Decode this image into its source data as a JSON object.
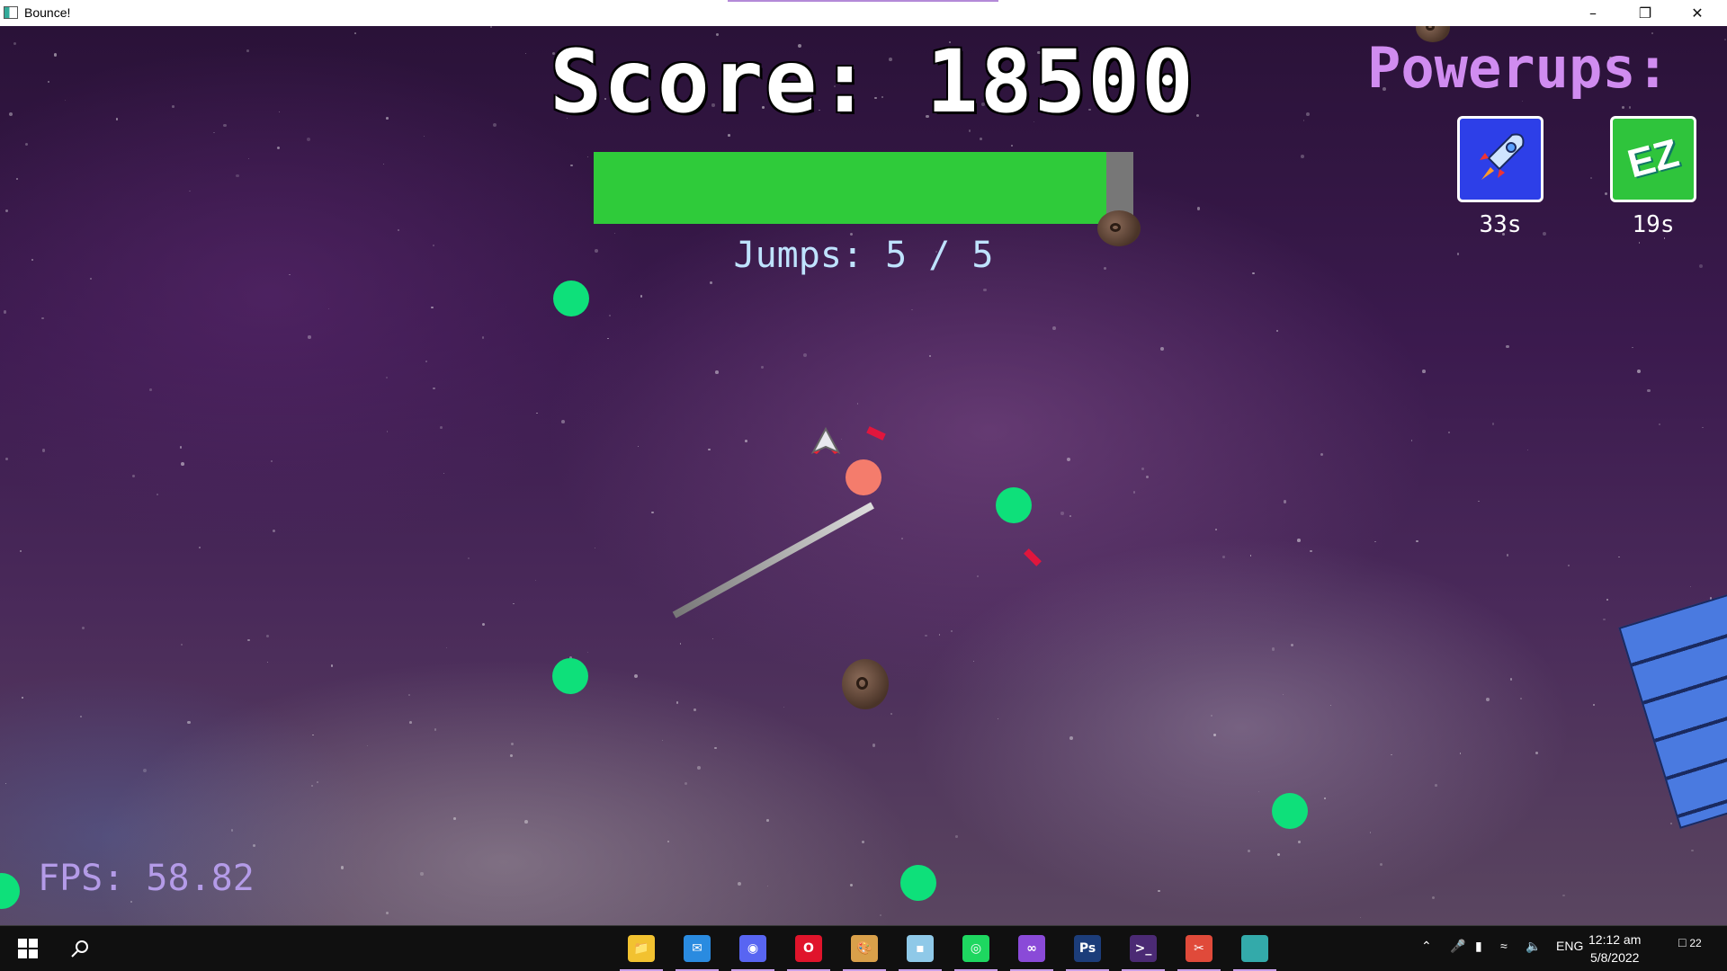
{
  "window": {
    "title": "Bounce!",
    "minimize_icon": "minimize-icon",
    "maximize_icon": "restore-icon",
    "close_icon": "close-icon"
  },
  "hud": {
    "score": "Score: 18500",
    "health_fraction": 0.95,
    "health_color": "#2fcb3a",
    "jumps": "Jumps: 5 / 5",
    "fps": "FPS: 58.82"
  },
  "powerups": {
    "title": "Powerups:",
    "items": [
      {
        "icon": "rocket-icon",
        "label": "",
        "time": "33s"
      },
      {
        "icon": "ez-icon",
        "label": "EZ",
        "time": "19s"
      }
    ]
  },
  "taskbar": {
    "apps": [
      "file-explorer-icon",
      "mail-icon",
      "discord-icon",
      "opera-icon",
      "paint-icon",
      "notes-icon",
      "spotify-icon",
      "visual-studio-icon",
      "photoshop-icon",
      "terminal-icon",
      "snipping-tool-icon",
      "bounce-app-icon"
    ],
    "tray": {
      "language": "ENG",
      "time": "12:12 am",
      "date": "5/8/2022",
      "notification_count": "22"
    }
  }
}
